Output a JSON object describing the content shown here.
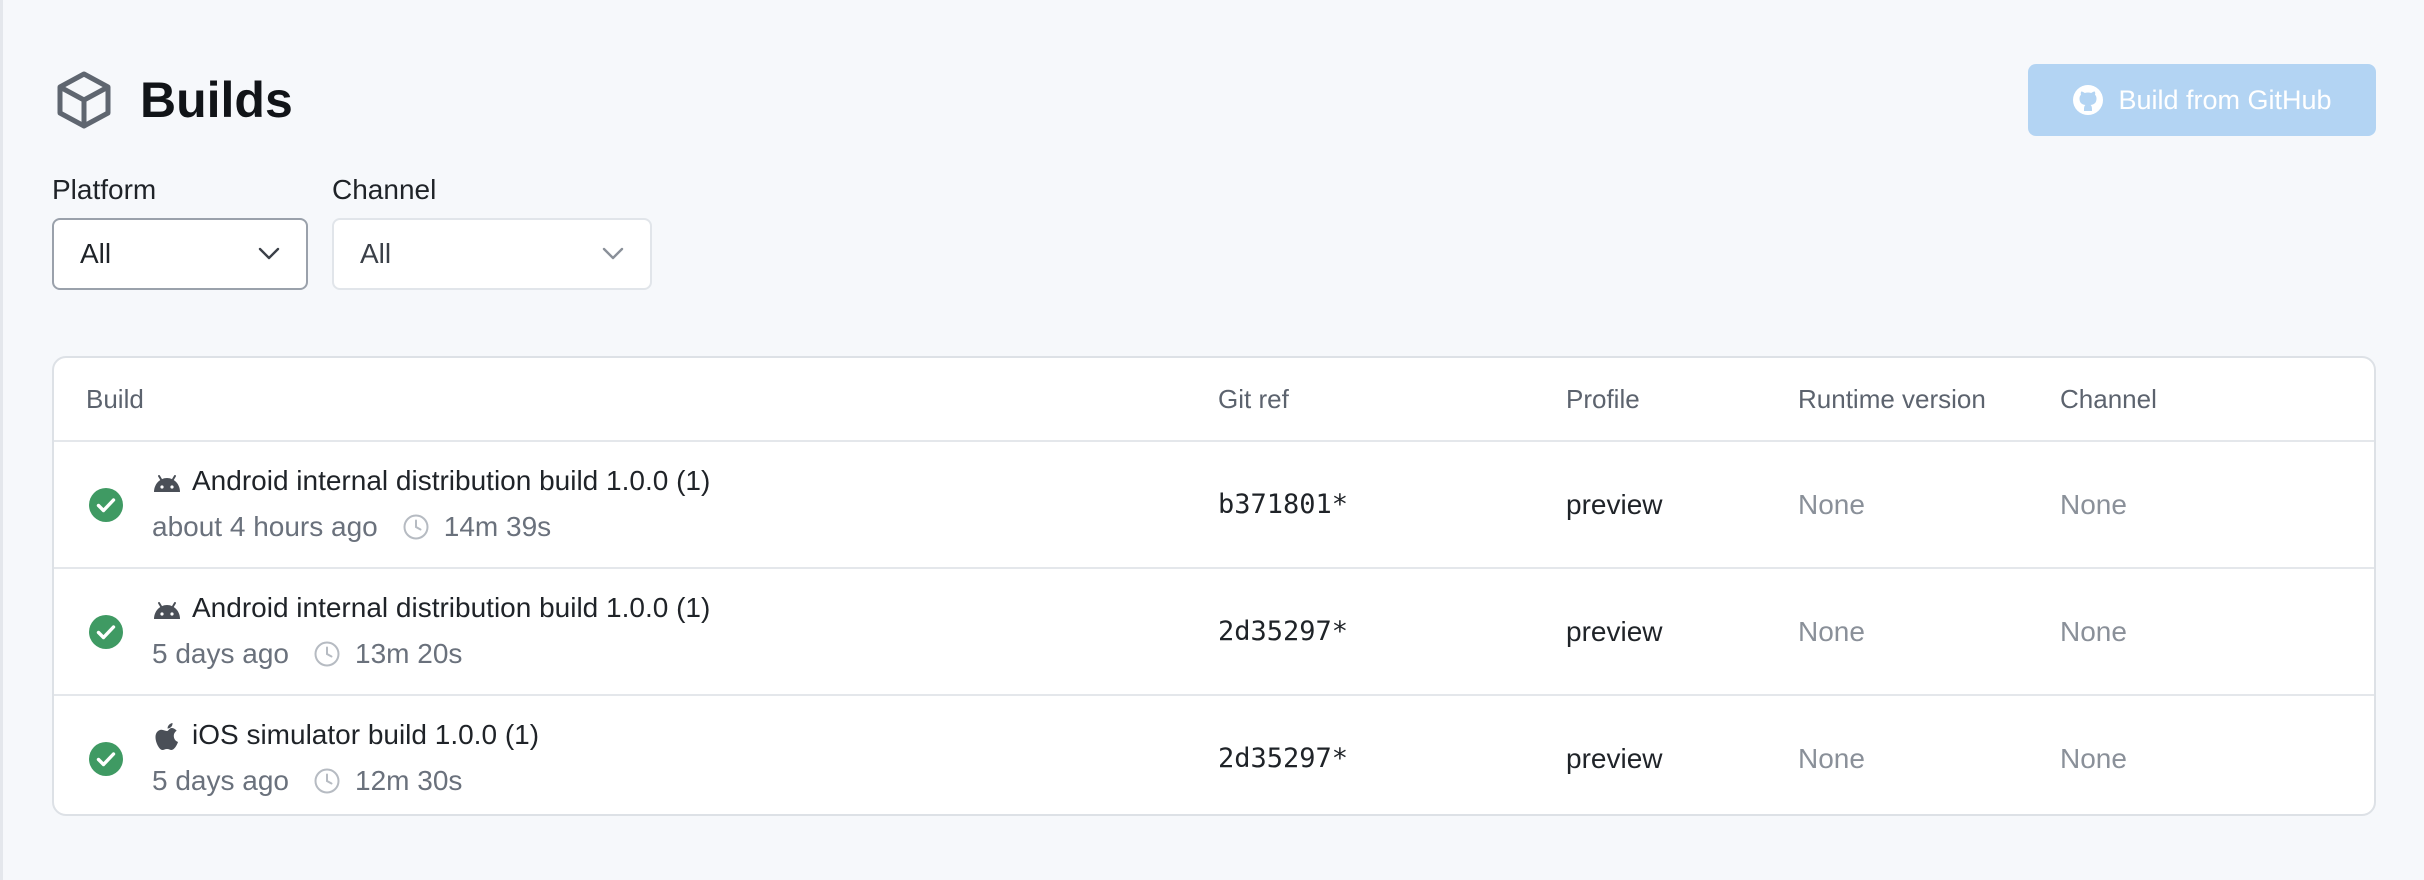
{
  "colors": {
    "accent_button": "#b3d4f3",
    "success": "#3f9a63",
    "page_bg": "#f6f8fb"
  },
  "header": {
    "icon": "cube-icon",
    "title": "Builds",
    "build_button": {
      "icon": "github-icon",
      "label": "Build from GitHub"
    }
  },
  "filters": {
    "platform": {
      "label": "Platform",
      "value": "All",
      "icon": "chevron-down-icon"
    },
    "channel": {
      "label": "Channel",
      "value": "All",
      "icon": "chevron-down-icon"
    }
  },
  "table": {
    "columns": [
      "Build",
      "Git ref",
      "Profile",
      "Runtime version",
      "Channel"
    ],
    "rows": [
      {
        "status_icon": "check-circle-icon",
        "platform_icon": "android-icon",
        "title": "Android internal distribution build 1.0.0 (1)",
        "time_ago": "about 4 hours ago",
        "duration": "14m 39s",
        "git_ref": "b371801*",
        "profile": "preview",
        "runtime_version": "None",
        "channel": "None"
      },
      {
        "status_icon": "check-circle-icon",
        "platform_icon": "android-icon",
        "title": "Android internal distribution build 1.0.0 (1)",
        "time_ago": "5 days ago",
        "duration": "13m 20s",
        "git_ref": "2d35297*",
        "profile": "preview",
        "runtime_version": "None",
        "channel": "None"
      },
      {
        "status_icon": "check-circle-icon",
        "platform_icon": "apple-icon",
        "title": "iOS simulator build 1.0.0 (1)",
        "time_ago": "5 days ago",
        "duration": "12m 30s",
        "git_ref": "2d35297*",
        "profile": "preview",
        "runtime_version": "None",
        "channel": "None"
      }
    ]
  }
}
